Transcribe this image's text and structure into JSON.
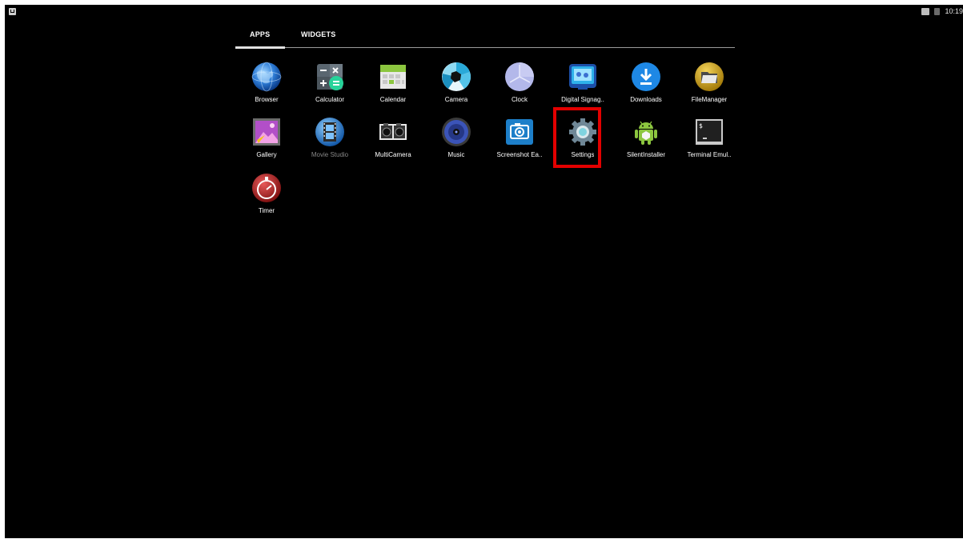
{
  "status_bar": {
    "left_icon": "notification-icon",
    "right_icons": [
      "cast-icon",
      "battery-icon"
    ],
    "time": "10:19"
  },
  "tabs": [
    {
      "label": "APPS",
      "selected": true
    },
    {
      "label": "WIDGETS",
      "selected": false
    }
  ],
  "apps": [
    {
      "label": "Browser",
      "icon": "globe-icon"
    },
    {
      "label": "Calculator",
      "icon": "calculator-icon"
    },
    {
      "label": "Calendar",
      "icon": "calendar-icon"
    },
    {
      "label": "Camera",
      "icon": "camera-aperture-icon"
    },
    {
      "label": "Clock",
      "icon": "clock-icon"
    },
    {
      "label": "Digital Signag..",
      "icon": "digital-signage-icon"
    },
    {
      "label": "Downloads",
      "icon": "download-icon"
    },
    {
      "label": "FileManager",
      "icon": "folder-icon"
    },
    {
      "label": "Gallery",
      "icon": "gallery-icon"
    },
    {
      "label": "Movie Studio",
      "icon": "film-icon"
    },
    {
      "label": "MultiCamera",
      "icon": "multicamera-icon"
    },
    {
      "label": "Music",
      "icon": "speaker-icon"
    },
    {
      "label": "Screenshot Ea..",
      "icon": "screenshot-camera-icon"
    },
    {
      "label": "Settings",
      "icon": "gear-icon"
    },
    {
      "label": "SilentInstaller",
      "icon": "android-icon"
    },
    {
      "label": "Terminal Emul..",
      "icon": "terminal-icon"
    },
    {
      "label": "Timer",
      "icon": "stopwatch-icon"
    }
  ],
  "highlighted_app": "Settings",
  "colors": {
    "background": "#000000",
    "highlight": "#e30000",
    "text": "#ffffff"
  }
}
